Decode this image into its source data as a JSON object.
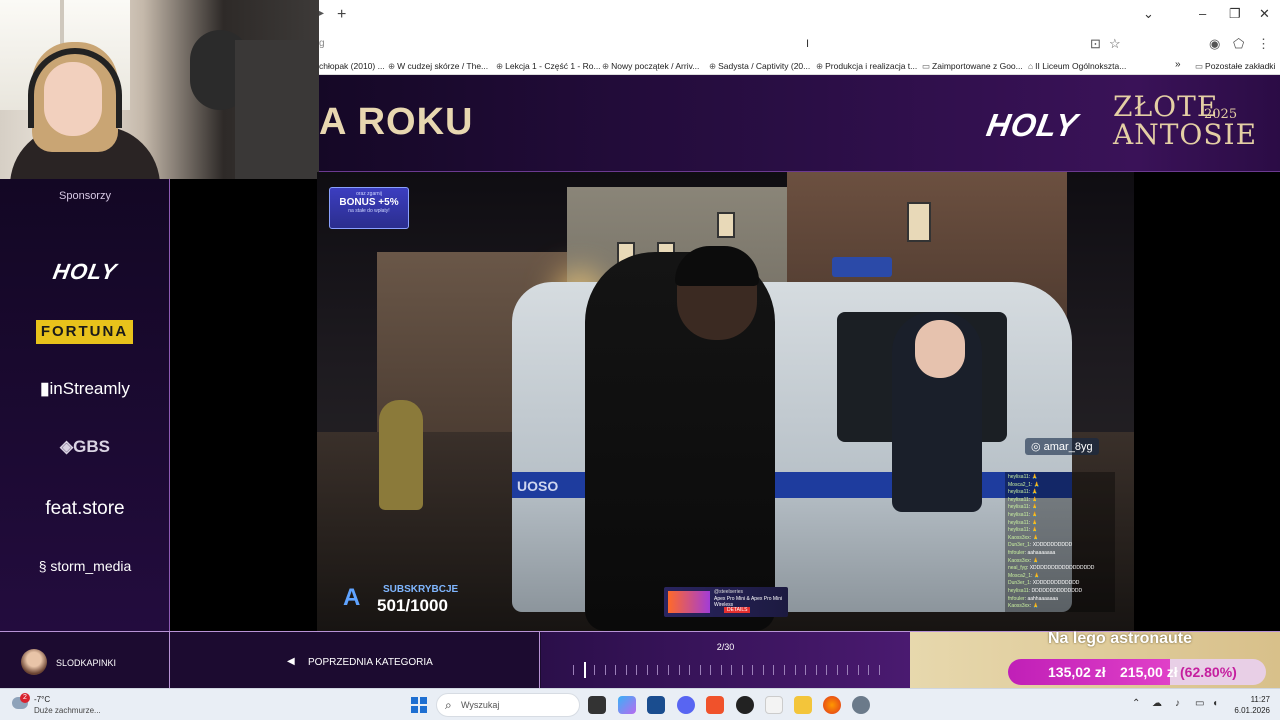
{
  "browser": {
    "url_fragment": "g",
    "bookmarks": [
      {
        "label": "chłopak (2010) ...",
        "icon": "globe-icon"
      },
      {
        "label": "W cudzej skórze / The...",
        "icon": "globe-icon"
      },
      {
        "label": "Lekcja 1 - Część 1 - Ro...",
        "icon": "globe-icon"
      },
      {
        "label": "Nowy początek / Arriv...",
        "icon": "globe-icon"
      },
      {
        "label": "Sadysta / Captivity (20...",
        "icon": "globe-icon"
      },
      {
        "label": "Produkcja i realizacja t...",
        "icon": "globe-icon"
      },
      {
        "label": "Zaimportowane z Goo...",
        "icon": "folder-icon"
      },
      {
        "label": "II Liceum Ogólnokszta...",
        "icon": "school-icon"
      }
    ],
    "other_bookmarks": "Pozostałe zakładki"
  },
  "stream": {
    "title_partial": "A ROKU",
    "holy_logo": "HOLY",
    "event_line1": "ZŁOTE",
    "event_line2": "ANTOSIE",
    "event_year": "2025"
  },
  "sidebar": {
    "heading": "Sponsorzy",
    "sponsors": [
      "HOLY",
      "FORTUNA",
      "inStreamly",
      "GBS",
      "feat.store",
      "storm_media"
    ]
  },
  "video": {
    "bonus": {
      "line1": "oraz zgarnij",
      "line2": "BONUS +5%",
      "line3": "na stałe do wpłaty!"
    },
    "van_text": "UOSO",
    "subs_label": "SUBSKRYBCJE",
    "subs_count": "501/1000",
    "promo": {
      "line1": "@steelseries",
      "line2": "Apex Pro Mini & Apex Pro Mini Wireless",
      "badge": "DETAILS"
    },
    "instagram": "amar_8yg",
    "chat": [
      {
        "user": "heylisa11",
        "msg": "🙏"
      },
      {
        "user": "Mosca2_1",
        "msg": "🙏"
      },
      {
        "user": "heylisa11",
        "msg": "🙏"
      },
      {
        "user": "heylisa11",
        "msg": "🙏"
      },
      {
        "user": "heylisa11",
        "msg": "🙏"
      },
      {
        "user": "heylisa11",
        "msg": "🙏"
      },
      {
        "user": "heylisa11",
        "msg": "🙏"
      },
      {
        "user": "heylisa11",
        "msg": "🙏"
      },
      {
        "user": "Kaoss3xx",
        "msg": "🙏"
      },
      {
        "user": "Dun3er_1",
        "msg": "XDDDDDDDDDD"
      },
      {
        "user": "fnfouler",
        "msg": "aahaaaaaaa"
      },
      {
        "user": "Kaoss3xx",
        "msg": "🙏"
      },
      {
        "user": "neal_fyg",
        "msg": "XDDDDDDDDDDDDDDDDD"
      },
      {
        "user": "Mosca2_1",
        "msg": "🙏"
      },
      {
        "user": "Dun3er_1",
        "msg": "XDDDDDDDDDDDD"
      },
      {
        "user": "heylisa11",
        "msg": "DDDDDDDDDDDDDD"
      },
      {
        "user": "fnfouler",
        "msg": "aahhaaaaaaa"
      },
      {
        "user": "Kaoss3xx",
        "msg": "🙏"
      }
    ]
  },
  "bottom": {
    "username": "SLODKAPINKI",
    "prev_label": "POPRZEDNIA KATEGORIA",
    "progress_label": "2/30",
    "progress_total": 30,
    "progress_current": 2,
    "goal_title": "Na lego astronaute",
    "goal_current": "135,02 zł",
    "goal_target": "215,00 zł",
    "goal_percent": "(62.80%)",
    "goal_fraction": 0.628
  },
  "taskbar": {
    "weather_badge": "2",
    "temp": "-7°C",
    "condition": "Duże zachmurze...",
    "search_placeholder": "Wyszukaj",
    "time": "11:27",
    "date": "6.01.2026"
  },
  "colors": {
    "accent_purple": "#2a0e45",
    "gold": "#e4cfa4",
    "goal_pink": "#c01fb7",
    "fortuna_yellow": "#e8c21b"
  }
}
